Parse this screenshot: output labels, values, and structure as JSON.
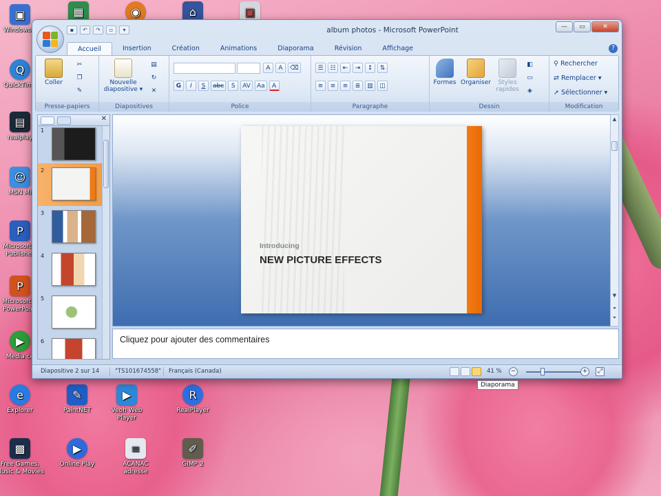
{
  "desktop": {
    "icons": [
      {
        "label": "Windows L",
        "color": "#3a6fd1"
      },
      {
        "label": "QuickTime",
        "color": "#2f83d6"
      },
      {
        "label": "realplay",
        "color": "#1b2a3a"
      },
      {
        "label": "MSN Mi",
        "color": "#3c8ee0"
      },
      {
        "label": "Microsoft P Publisher",
        "color": "#2b5fbf"
      },
      {
        "label": "Microsoft O PowerPoint",
        "color": "#d2521d"
      },
      {
        "label": "Media ce",
        "color": "#2c9e3a"
      },
      {
        "label": "Explorer",
        "color": "#2a7be0"
      },
      {
        "label": "PaintNET",
        "color": "#1f5ec5"
      },
      {
        "label": "Veoh Web Player",
        "color": "#2e87d8"
      },
      {
        "label": "RealPlayer",
        "color": "#2c6fe0"
      },
      {
        "label": "Free Games, Music & Movies",
        "color": "#1c2e4a"
      },
      {
        "label": "Online Play",
        "color": "#2f6ad8"
      },
      {
        "label": "ACANAC adresse",
        "color": "#e4e8ef"
      },
      {
        "label": "GIMP 2",
        "color": "#605c4e"
      }
    ],
    "tooltip": "Diaporama"
  },
  "window": {
    "title_doc": "album photos",
    "title_app": "- Microsoft PowerPoint",
    "minimize": "—",
    "maximize": "▭",
    "close": "✕",
    "help": "?"
  },
  "ribbon": {
    "tabs": [
      "Accueil",
      "Insertion",
      "Création",
      "Animations",
      "Diaporama",
      "Révision",
      "Affichage"
    ],
    "groups": {
      "clipboard": {
        "label": "Presse-papiers",
        "paste": "Coller"
      },
      "slides": {
        "label": "Diapositives",
        "new_slide": "Nouvelle diapositive ▾"
      },
      "font": {
        "label": "Police"
      },
      "paragraph": {
        "label": "Paragraphe"
      },
      "drawing": {
        "label": "Dessin",
        "shapes": "Formes",
        "arrange": "Organiser",
        "quick_styles": "Styles rapides"
      },
      "editing": {
        "label": "Modification",
        "find": "Rechercher",
        "replace": "Remplacer ▾",
        "select": "Sélectionner ▾"
      }
    }
  },
  "thumbnails": [
    {
      "num": "1"
    },
    {
      "num": "2"
    },
    {
      "num": "3"
    },
    {
      "num": "4"
    },
    {
      "num": "5"
    },
    {
      "num": "6"
    }
  ],
  "slide": {
    "intro": "Introducing",
    "headline": "NEW PICTURE EFFECTS"
  },
  "notes": {
    "placeholder": "Cliquez pour ajouter des commentaires"
  },
  "status": {
    "slide_info": "Diapositive 2 sur 14",
    "theme": "\"TS101674558\"",
    "language": "Français (Canada)",
    "zoom": "41 %"
  }
}
